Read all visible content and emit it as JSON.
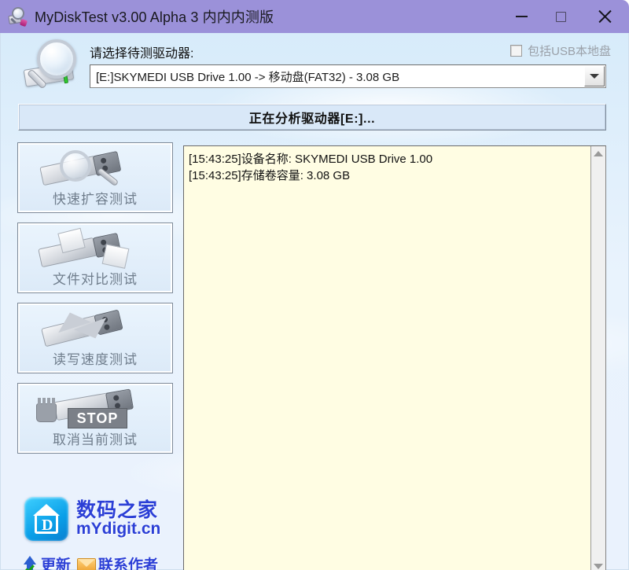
{
  "titlebar": {
    "title": "MyDiskTest v3.00 Alpha 3 内内内测版",
    "app_icon": "magnifier-disk-icon",
    "minimize_label": "—",
    "maximize_label": "□",
    "close_label": "✕"
  },
  "header": {
    "hero_icon": "magnifier-usb-icon",
    "select_drive_label": "请选择待测驱动器:",
    "include_local_usb_label": "包括USB本地盘",
    "include_local_usb_checked": false,
    "drive_value": "[E:]SKYMEDI USB Drive 1.00 -> 移动盘(FAT32) - 3.08 GB",
    "dropdown_icon": "chevron-down-icon"
  },
  "status": {
    "text": "正在分析驱动器[E:]..."
  },
  "sidebar": {
    "buttons": [
      {
        "label": "快速扩容测试",
        "icon": "usb-magnifier-icon"
      },
      {
        "label": "文件对比测试",
        "icon": "usb-files-compare-icon"
      },
      {
        "label": "读写速度测试",
        "icon": "usb-speed-icon"
      },
      {
        "label": "取消当前测试",
        "icon": "usb-stop-icon"
      }
    ]
  },
  "log": {
    "lines": [
      "[15:43:25]设备名称: SKYMEDI USB Drive 1.00",
      "[15:43:25]存储卷容量: 3.08 GB"
    ],
    "text": "[15:43:25]设备名称: SKYMEDI USB Drive 1.00\n[15:43:25]存储卷容量: 3.08 GB",
    "scroll_up_icon": "triangle-up-icon",
    "scroll_down_icon": "triangle-down-icon"
  },
  "brand": {
    "logo_icon": "mydigit-house-logo",
    "logo_letter": "D",
    "name_cn": "数码之家",
    "name_en": "mYdigit.cn"
  },
  "links": [
    {
      "label": "更新",
      "icon": "update-arrow-icon"
    },
    {
      "label": "联系作者",
      "icon": "envelope-icon"
    }
  ],
  "colors": {
    "titlebar": "#9b91d9",
    "client_bg": "#e3effb",
    "log_bg": "#fffde3",
    "status_bg": "#d9e8f8",
    "link": "#2b3fd6",
    "caption_text": "#6f7d8c"
  }
}
